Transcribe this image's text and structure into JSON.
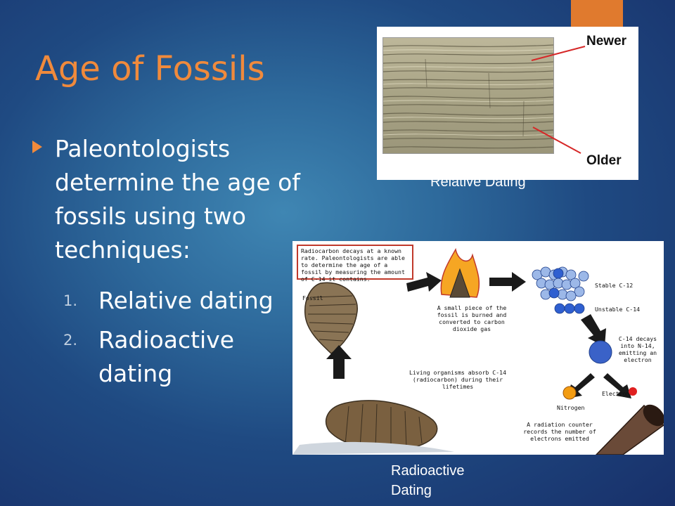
{
  "slide": {
    "title": "Age of Fossils",
    "bullet": "Paleontologists determine the age of fossils using two techniques:",
    "techniques": [
      {
        "number": "1.",
        "label": "Relative dating"
      },
      {
        "number": "2.",
        "label": "Radioactive dating"
      }
    ],
    "accent_color": "#e07a2e",
    "title_color": "#f08a3c"
  },
  "figure_relative": {
    "newer_label": "Newer",
    "older_label": "Older",
    "caption": "Relative Dating"
  },
  "figure_radioactive": {
    "note": "Radiocarbon decays at a known rate. Paleontologists are able to determine the age of a fossil by measuring the amount of C-14 it contains.",
    "fossil_label": "Fossil",
    "burn_text": "A small piece of the fossil is burned and converted to carbon dioxide gas",
    "stable_label": "Stable C-12",
    "unstable_label": "Unstable C-14",
    "decay_text": "C-14 decays into N-14, emitting an electron",
    "living_text": "Living organisms absorb C-14 (radiocarbon) during their lifetimes",
    "nitrogen_label": "Nitrogen",
    "electron_label": "Electron",
    "counter_text": "A radiation counter records the number of electrons emitted",
    "caption": "Radioactive Dating"
  }
}
